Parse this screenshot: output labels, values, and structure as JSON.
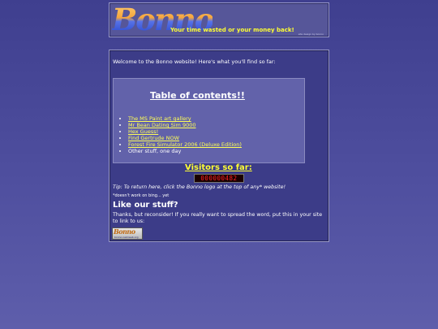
{
  "header": {
    "logo_text": "Bonno",
    "tagline": "Your time wasted or your money back!",
    "credit": "site design by bonno"
  },
  "main": {
    "welcome": "Welcome to the Bonno website! Here's what you'll find so far:",
    "toc": {
      "title": "Table of contents!!",
      "items": [
        {
          "label": "The MS Paint art gallery",
          "is_link": true
        },
        {
          "label": "Mr Bean Dating Sim 9000",
          "is_link": true
        },
        {
          "label": "Hex Guess!",
          "is_link": true
        },
        {
          "label": "Find Gertrude NOW",
          "is_link": true
        },
        {
          "label": "Forest Fire Simulator 2006 (Deluxe Edition)",
          "is_link": true
        },
        {
          "label": "Other stuff, one day",
          "is_link": false
        }
      ]
    },
    "visitors_label": "Visitors so far:",
    "visitor_count": "000000482",
    "tip": "Tip: To return here, click the Bonno logo at the top of any* website!",
    "footnote": "*doesn't work on bing... yet",
    "like_heading": "Like our stuff?",
    "share_text": "Thanks, but reconsider! If you really want to spread the word, put this in your site to link to us:",
    "badge": {
      "logo_text": "Bonno",
      "subtext": "bonno.nekoweb.org"
    }
  },
  "colors": {
    "background": "#4a4a99",
    "panel": "#3c3c88",
    "toc_box": "#6262aa",
    "link": "#ffff55",
    "accent_yellow": "#ffff33",
    "counter_digits": "#ff2222"
  }
}
